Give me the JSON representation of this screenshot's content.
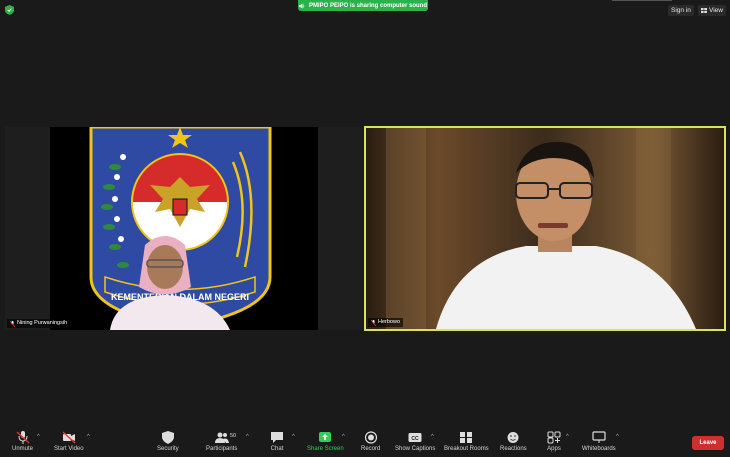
{
  "topbar": {
    "sharing_text": "PMIPO PEIPO is sharing computer sound",
    "sign_in": "Sign in",
    "view": "View"
  },
  "participants_tiles": [
    {
      "name": "Nining Purwaningsih",
      "logo_text": "KEMENTERIAN DALAM NEGERI"
    },
    {
      "name": "Herbowo"
    }
  ],
  "toolbar": {
    "unmute": "Unmute",
    "start_video": "Start Video",
    "security": "Security",
    "participants": "Participants",
    "participants_count": "50",
    "chat": "Chat",
    "share_screen": "Share Screen",
    "record": "Record",
    "show_captions": "Show Captions",
    "breakout_rooms": "Breakout Rooms",
    "reactions": "Reactions",
    "apps": "Apps",
    "whiteboards": "Whiteboards",
    "leave": "Leave"
  },
  "colors": {
    "sharing_banner": "#2bb24c",
    "active_speaker_border": "#d8e35b",
    "leave_button": "#d02f2f",
    "share_screen": "#2fcf5a"
  }
}
